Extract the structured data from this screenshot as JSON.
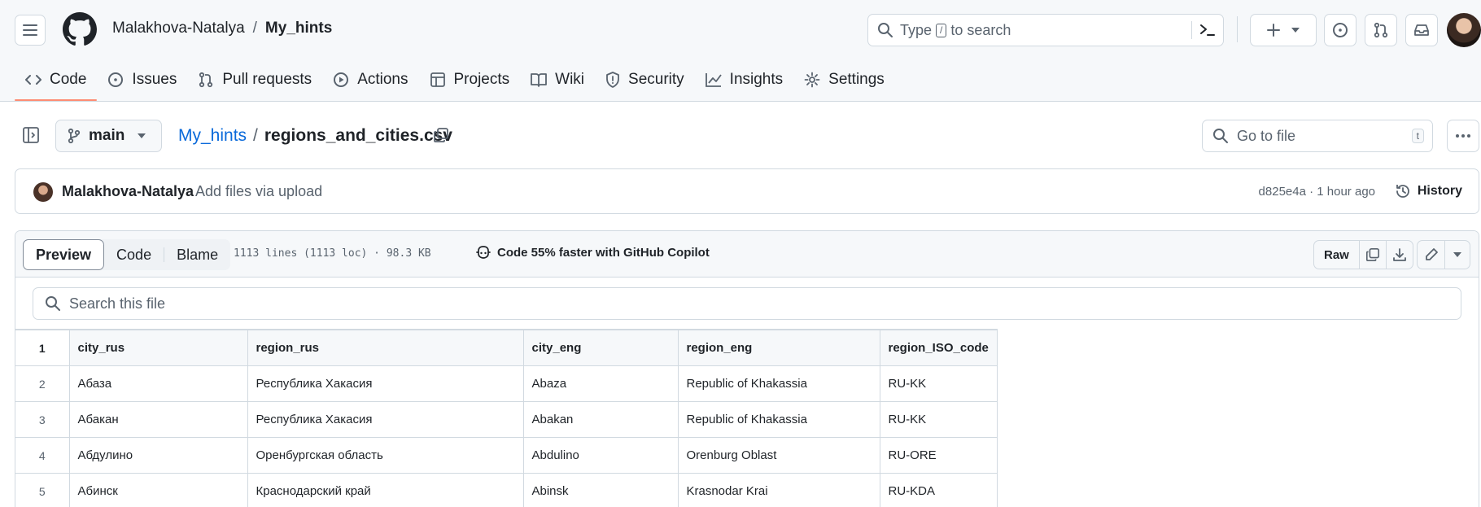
{
  "header": {
    "owner": "Malakhova-Natalya",
    "separator": "/",
    "repo": "My_hints",
    "search_prefix": "Type",
    "search_key": "/",
    "search_suffix": "to search"
  },
  "tabs": [
    {
      "label": "Code",
      "icon": "code-icon"
    },
    {
      "label": "Issues",
      "icon": "issue-icon"
    },
    {
      "label": "Pull requests",
      "icon": "pull-request-icon"
    },
    {
      "label": "Actions",
      "icon": "play-icon"
    },
    {
      "label": "Projects",
      "icon": "table-icon"
    },
    {
      "label": "Wiki",
      "icon": "book-icon"
    },
    {
      "label": "Security",
      "icon": "shield-icon"
    },
    {
      "label": "Insights",
      "icon": "graph-icon"
    },
    {
      "label": "Settings",
      "icon": "gear-icon"
    }
  ],
  "filenav": {
    "branch": "main",
    "repo_link": "My_hints",
    "slash": "/",
    "filename": "regions_and_cities.csv",
    "goto_placeholder": "Go to file",
    "goto_key": "t"
  },
  "commit": {
    "author": "Malakhova-Natalya",
    "message": "Add files via upload",
    "meta": "d825e4a · 1 hour ago",
    "history": "History"
  },
  "viewer": {
    "modes": [
      "Preview",
      "Code",
      "Blame"
    ],
    "stats": "1113 lines (1113 loc) · 98.3 KB",
    "copilot": "Code 55% faster with GitHub Copilot",
    "raw": "Raw",
    "search_placeholder": "Search this file"
  },
  "csv": {
    "columns": [
      "city_rus",
      "region_rus",
      "city_eng",
      "region_eng",
      "region_ISO_code"
    ],
    "rows": [
      {
        "line": "2",
        "cells": [
          "Абаза",
          "Республика Хакасия",
          "Abaza",
          "Republic of Khakassia",
          "RU-KK"
        ]
      },
      {
        "line": "3",
        "cells": [
          "Абакан",
          "Республика Хакасия",
          "Abakan",
          "Republic of Khakassia",
          "RU-KK"
        ]
      },
      {
        "line": "4",
        "cells": [
          "Абдулино",
          "Оренбургская область",
          "Abdulino",
          "Orenburg Oblast",
          "RU-ORE"
        ]
      },
      {
        "line": "5",
        "cells": [
          "Абинск",
          "Краснодарский край",
          "Abinsk",
          "Krasnodar Krai",
          "RU-KDA"
        ]
      }
    ]
  },
  "colors": {
    "link": "#0969da",
    "tab_underline": "#fd8c73",
    "muted": "#59636e",
    "border": "#d1d9e0"
  }
}
